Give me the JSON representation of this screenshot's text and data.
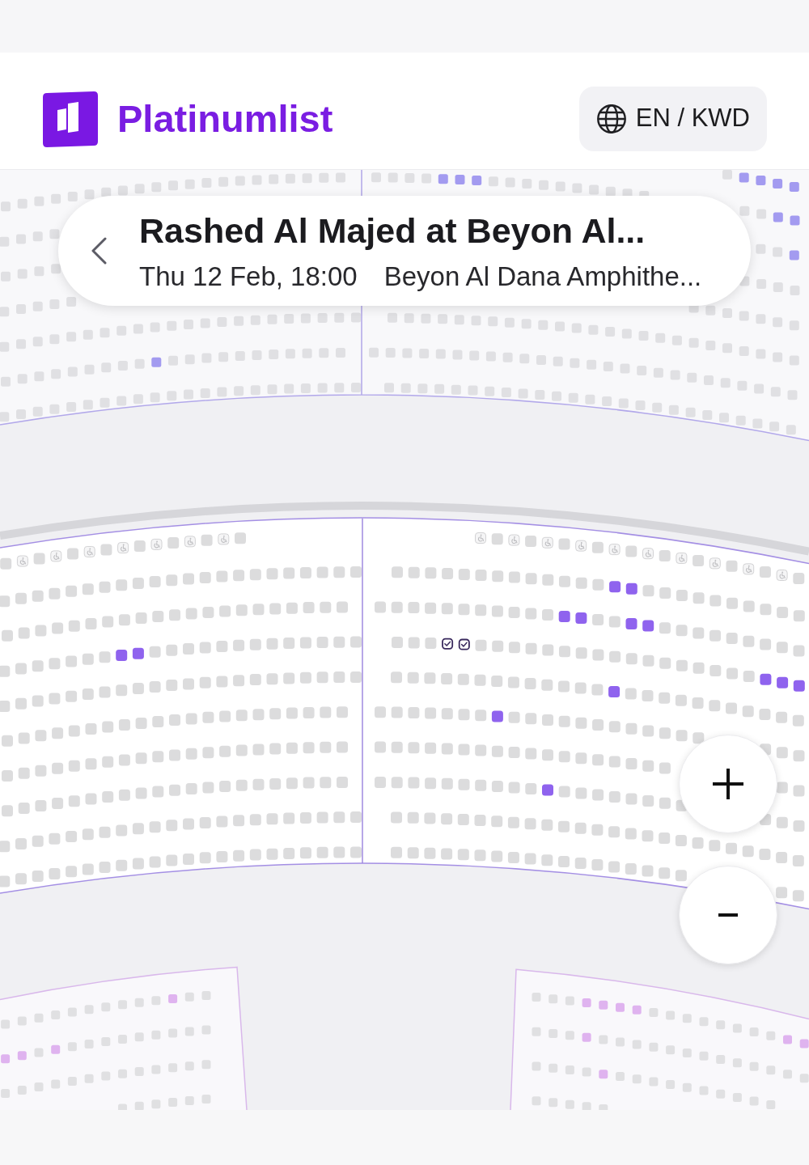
{
  "header": {
    "logo": {
      "text": "Platinumlist"
    },
    "locale_button": {
      "label": "EN / KWD"
    }
  },
  "event": {
    "title": "Rashed Al Majed at Beyon Al...",
    "date_time": "Thu 12 Feb, 18:00",
    "venue": "Beyon Al Dana Amphithe..."
  },
  "seat_map": {
    "sections": [
      {
        "color": "#a39bf0",
        "rows": [
          {
            "kind": "standard",
            "seats": [
              false,
              false,
              false,
              false,
              false,
              false,
              false,
              false,
              false,
              false,
              false,
              false,
              false,
              false,
              false,
              false,
              false,
              false,
              false,
              false,
              false
            ]
          },
          {
            "kind": "standard",
            "seats": [
              false,
              false,
              false,
              false
            ]
          },
          {
            "kind": "standard",
            "seats": [
              false,
              false,
              false,
              false
            ]
          },
          {
            "kind": "standard",
            "seats": [
              false,
              false,
              false,
              false,
              false
            ]
          },
          {
            "kind": "standard",
            "seats": [
              false,
              false,
              false,
              false,
              false,
              false,
              false,
              false,
              false,
              false,
              false,
              false,
              false,
              false,
              false,
              false,
              false,
              false,
              false,
              false,
              false,
              false
            ]
          },
          {
            "kind": "standard",
            "seats": [
              false,
              false,
              false,
              false,
              false,
              false,
              false,
              false,
              false,
              true,
              false,
              false,
              false,
              false,
              false,
              false,
              false,
              false,
              false,
              false,
              false
            ]
          },
          {
            "kind": "standard",
            "seats": [
              false,
              false,
              false,
              false,
              false,
              false,
              false,
              false,
              false,
              false,
              false,
              false,
              false,
              false,
              false,
              false,
              false,
              false,
              false,
              false,
              false,
              false
            ]
          }
        ]
      },
      {
        "color": "#a39bf0",
        "rows": [
          {
            "kind": "standard",
            "seats": [
              false,
              true,
              true,
              true,
              true
            ]
          },
          {
            "kind": "standard",
            "seats": [
              false,
              false,
              false,
              false,
              true,
              true,
              true,
              false,
              false,
              false,
              false,
              false,
              false,
              false,
              false,
              false,
              false,
              false,
              false,
              true,
              true
            ]
          },
          {
            "kind": "standard",
            "seats": [
              false,
              false,
              true
            ]
          },
          {
            "kind": "standard",
            "seats": [
              false,
              false,
              false,
              false
            ]
          },
          {
            "kind": "standard",
            "seats": [
              false,
              false,
              false,
              false,
              false,
              false,
              false
            ]
          },
          {
            "kind": "standard",
            "seats": [
              false,
              false,
              false,
              false,
              false,
              false,
              false,
              false,
              false,
              false,
              false,
              false,
              false,
              false,
              false,
              false,
              false,
              false,
              false,
              false,
              false,
              false,
              false,
              false,
              false
            ]
          },
          {
            "kind": "standard",
            "seats": [
              false,
              false,
              false,
              false,
              false,
              false,
              false,
              false,
              false,
              false,
              false,
              false,
              false,
              false,
              false,
              false,
              false,
              false,
              false,
              false,
              false,
              false,
              false,
              false,
              false,
              false
            ]
          },
          {
            "kind": "standard",
            "seats": [
              false,
              false,
              false,
              false,
              false,
              false,
              false,
              false,
              false,
              false,
              false,
              false,
              false,
              false,
              false,
              false,
              false,
              false,
              false,
              false,
              false,
              false,
              false,
              false,
              false
            ]
          }
        ]
      },
      {
        "color": "#8f63ee",
        "rows": [
          {
            "kind": "accessible",
            "seats": [
              false,
              true,
              false,
              true,
              false,
              true,
              false,
              true,
              false,
              true,
              false,
              true,
              false,
              true,
              false
            ]
          },
          {
            "kind": "standard",
            "seats": [
              false,
              false,
              false,
              false,
              false,
              false,
              false,
              false,
              false,
              false,
              false,
              false,
              false,
              false,
              false,
              false,
              false,
              false,
              false,
              false,
              false,
              false
            ]
          },
          {
            "kind": "standard",
            "seats": [
              false,
              false,
              false,
              false,
              false,
              false,
              false,
              false,
              false,
              false,
              false,
              false,
              false,
              false,
              false,
              false,
              false,
              false,
              false,
              false,
              false
            ]
          },
          {
            "kind": "standard",
            "seats": [
              false,
              false,
              false,
              false,
              false,
              false,
              false,
              true,
              true,
              false,
              false,
              false,
              false,
              false,
              false,
              false,
              false,
              false,
              false,
              false,
              false,
              false
            ]
          },
          {
            "kind": "standard",
            "seats": [
              false,
              false,
              false,
              false,
              false,
              false,
              false,
              false,
              false,
              false,
              false,
              false,
              false,
              false,
              false,
              false,
              false,
              false,
              false,
              false,
              false,
              false
            ]
          },
          {
            "kind": "standard",
            "seats": [
              false,
              false,
              false,
              false,
              false,
              false,
              false,
              false,
              false,
              false,
              false,
              false,
              false,
              false,
              false,
              false,
              false,
              false,
              false,
              false,
              false
            ]
          },
          {
            "kind": "standard",
            "seats": [
              false,
              false,
              false,
              false,
              false,
              false,
              false,
              false,
              false,
              false,
              false,
              false,
              false,
              false,
              false,
              false,
              false,
              false,
              false,
              false,
              false
            ]
          },
          {
            "kind": "standard",
            "seats": [
              false,
              false,
              false,
              false,
              false,
              false,
              false,
              false,
              false,
              false,
              false,
              false,
              false,
              false,
              false,
              false,
              false,
              false,
              false,
              false,
              false
            ]
          },
          {
            "kind": "standard",
            "seats": [
              false,
              false,
              false,
              false,
              false,
              false,
              false,
              false,
              false,
              false,
              false,
              false,
              false,
              false,
              false,
              false,
              false,
              false,
              false,
              false,
              false,
              false
            ]
          },
          {
            "kind": "standard",
            "seats": [
              false,
              false,
              false,
              false,
              false,
              false,
              false,
              false,
              false,
              false,
              false,
              false,
              false,
              false,
              false,
              false,
              false,
              false,
              false,
              false,
              false,
              false
            ]
          }
        ]
      },
      {
        "color": "#8f63ee",
        "rows": [
          {
            "kind": "accessible",
            "seats": [
              true,
              false,
              true,
              false,
              true,
              false,
              true,
              false,
              true,
              false,
              true,
              false,
              true,
              false,
              true,
              false,
              true,
              false,
              true,
              false
            ]
          },
          {
            "kind": "standard",
            "seats": [
              false,
              false,
              false,
              false,
              false,
              false,
              false,
              false,
              false,
              false,
              false,
              false,
              false,
              true,
              true,
              false,
              false,
              false,
              false,
              false,
              false,
              false,
              false,
              false,
              false
            ]
          },
          {
            "kind": "standard",
            "seats": [
              false,
              false,
              false,
              false,
              false,
              false,
              false,
              false,
              false,
              false,
              false,
              true,
              true,
              false,
              false,
              true,
              true,
              false,
              false,
              false,
              false,
              false,
              false,
              false,
              false,
              false
            ]
          },
          {
            "kind": "standard",
            "seats": [
              false,
              false,
              false,
              false,
              false,
              false,
              false,
              false,
              false,
              false,
              false,
              false,
              false,
              false,
              false,
              false,
              false,
              false,
              false,
              false,
              false,
              false,
              true,
              true,
              true
            ],
            "selected": [
              false,
              false,
              false,
              true,
              true,
              false,
              false,
              false,
              false,
              false,
              false,
              false,
              false,
              false,
              false,
              false,
              false,
              false,
              false,
              false,
              false,
              false,
              false,
              false,
              false
            ]
          },
          {
            "kind": "standard",
            "seats": [
              false,
              false,
              false,
              false,
              false,
              false,
              false,
              false,
              false,
              false,
              false,
              false,
              false,
              true,
              false,
              false,
              false,
              false,
              false,
              false,
              false,
              false,
              false,
              false,
              false
            ]
          },
          {
            "kind": "standard",
            "seats": [
              false,
              false,
              false,
              false,
              false,
              false,
              false,
              true,
              false,
              false,
              false,
              false,
              false,
              false,
              false,
              false,
              false,
              false,
              false,
              false,
              false,
              false,
              false
            ]
          },
          {
            "kind": "standard",
            "seats": [
              false,
              false,
              false,
              false,
              false,
              false,
              false,
              false,
              false,
              false,
              false,
              false,
              false,
              false,
              false,
              false,
              false,
              false,
              false,
              false
            ]
          },
          {
            "kind": "standard",
            "seats": [
              false,
              false,
              false,
              false,
              false,
              false,
              false,
              false,
              false,
              false,
              true,
              false,
              false,
              false,
              false,
              false,
              false,
              false,
              false,
              false,
              false,
              false
            ]
          },
          {
            "kind": "standard",
            "seats": [
              false,
              false,
              false,
              false,
              false,
              false,
              false,
              false,
              false,
              false,
              false,
              false,
              false,
              false,
              false,
              false,
              false,
              false,
              false,
              false,
              false,
              false,
              false,
              false,
              false
            ]
          },
          {
            "kind": "standard",
            "seats": [
              false,
              false,
              false,
              false,
              false,
              false,
              false,
              false,
              false,
              false,
              false,
              false,
              false,
              false,
              false,
              false,
              false,
              false,
              false,
              false
            ]
          }
        ]
      },
      {
        "color": "#dfb3ef",
        "rows": [
          {
            "kind": "standard",
            "seats": [
              false,
              false,
              false,
              false,
              false,
              false,
              false,
              false,
              false,
              false,
              true,
              false,
              false
            ]
          },
          {
            "kind": "standard",
            "seats": [
              true,
              true,
              false,
              true,
              false,
              false,
              false,
              false,
              false,
              false,
              false,
              false,
              false
            ]
          },
          {
            "kind": "standard",
            "seats": [
              false,
              false,
              false,
              false,
              false,
              false,
              false,
              false,
              false,
              false,
              false,
              false,
              false
            ]
          },
          {
            "kind": "standard",
            "seats": [
              false,
              false,
              false,
              false,
              false,
              false
            ]
          }
        ]
      },
      {
        "color": "#dfb3ef",
        "rows": [
          {
            "kind": "standard",
            "seats": [
              false,
              false,
              false,
              true,
              true,
              true,
              true,
              false,
              false,
              false,
              false,
              false,
              false,
              false,
              false,
              true,
              true
            ]
          },
          {
            "kind": "standard",
            "seats": [
              false,
              false,
              false,
              true,
              false,
              false,
              false,
              false,
              false,
              false,
              false,
              false,
              false,
              false,
              false,
              false,
              false
            ]
          },
          {
            "kind": "standard",
            "seats": [
              false,
              false,
              false,
              false,
              true,
              false,
              false,
              false,
              false,
              false,
              false,
              false,
              false,
              false,
              false
            ]
          },
          {
            "kind": "standard",
            "seats": [
              false,
              false,
              false,
              false,
              false
            ]
          }
        ]
      }
    ]
  }
}
